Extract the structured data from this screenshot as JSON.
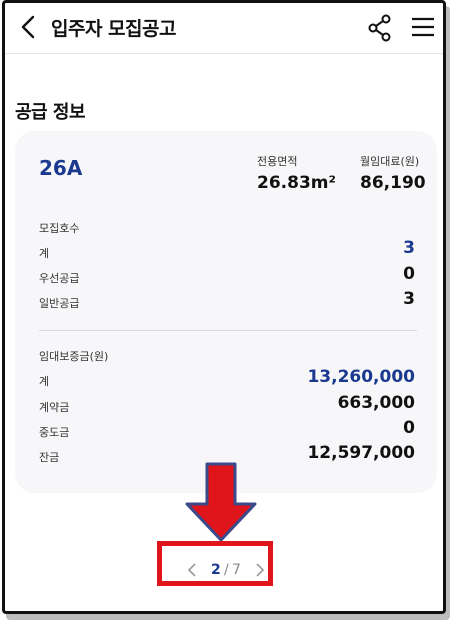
{
  "header": {
    "title": "입주자 모집공고"
  },
  "section": {
    "title": "공급 정보"
  },
  "card": {
    "type_name": "26A",
    "area_label": "전용면적",
    "area_value": "26.83m²",
    "rent_label": "월임대료(원)",
    "rent_value": "86,190",
    "units": {
      "title": "모집호수",
      "rows": [
        {
          "label": "계",
          "value": "3"
        },
        {
          "label": "우선공급",
          "value": "0"
        },
        {
          "label": "일반공급",
          "value": "3"
        }
      ]
    },
    "deposit": {
      "title": "임대보증금(원)",
      "rows": [
        {
          "label": "계",
          "value": "13,260,000"
        },
        {
          "label": "계약금",
          "value": "663,000"
        },
        {
          "label": "중도금",
          "value": "0"
        },
        {
          "label": "잔금",
          "value": "12,597,000"
        }
      ]
    }
  },
  "pagination": {
    "current": "2",
    "separator": "/",
    "total": "7"
  },
  "colors": {
    "accent_blue": "#1b3a8f",
    "highlight_red": "#e0141b"
  },
  "icons": [
    "back-arrow-icon",
    "share-icon",
    "menu-icon",
    "chevron-left-icon",
    "chevron-right-icon",
    "down-arrow-annotation-icon"
  ]
}
